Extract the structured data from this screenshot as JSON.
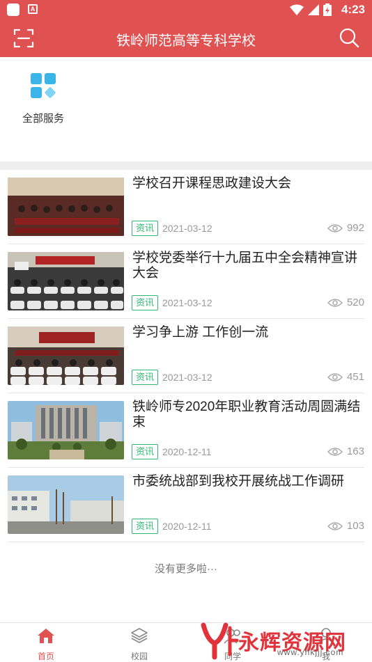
{
  "status_bar": {
    "time": "4:23",
    "notification_letter": "A"
  },
  "app_bar": {
    "title": "铁岭师范高等专科学校"
  },
  "services": [
    {
      "label": "全部服务"
    }
  ],
  "news": [
    {
      "title": "学校召开课程思政建设大会",
      "tag": "资讯",
      "date": "2021-03-12",
      "views": "992"
    },
    {
      "title": "学校党委举行十九届五中全会精神宣讲大会",
      "tag": "资讯",
      "date": "2021-03-12",
      "views": "520"
    },
    {
      "title": "学习争上游 工作创一流",
      "tag": "资讯",
      "date": "2021-03-12",
      "views": "451"
    },
    {
      "title": "铁岭师专2020年职业教育活动周圆满结束",
      "tag": "资讯",
      "date": "2020-12-11",
      "views": "163"
    },
    {
      "title": "市委统战部到我校开展统战工作调研",
      "tag": "资讯",
      "date": "2020-12-11",
      "views": "103"
    }
  ],
  "no_more": "没有更多啦···",
  "tabs": [
    {
      "label": "首页",
      "icon": "home-icon",
      "active": true
    },
    {
      "label": "校园",
      "icon": "layers-icon",
      "active": false
    },
    {
      "label": "同学",
      "icon": "people-icon",
      "active": false
    },
    {
      "label": "我",
      "icon": "user-icon",
      "active": false
    }
  ],
  "watermark": {
    "brand": "永辉资源网",
    "url": "www.yhkjjj.com"
  },
  "colors": {
    "primary": "#e05252",
    "tag_green": "#2eb872",
    "service_blue": "#3bb4e8"
  }
}
